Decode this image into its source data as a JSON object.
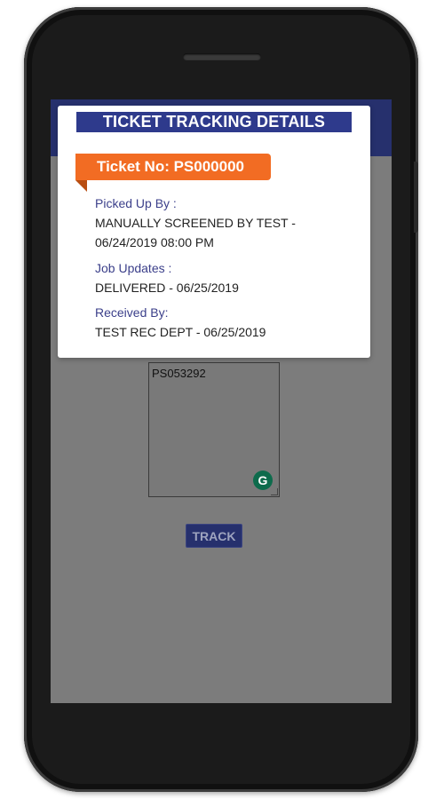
{
  "popup": {
    "title": "TICKET TRACKING DETAILS",
    "ticket_no": "Ticket No: PS000000",
    "fields": [
      {
        "label": "Picked Up By :",
        "value": "MANUALLY SCREENED BY TEST - 06/24/2019 08:00 PM"
      },
      {
        "label": "Job Updates :",
        "value": "DELIVERED - 06/25/2019"
      },
      {
        "label": "Received By:",
        "value": "TEST REC DEPT - 06/25/2019"
      }
    ]
  },
  "form": {
    "ticket_input_value": "PS053292",
    "track_label": "TRACK",
    "grammarly_glyph": "G"
  },
  "colors": {
    "header": "#26306d",
    "title_bar": "#2e3a8c",
    "badge": "#f26c23",
    "label": "#3b3f8a",
    "overlay": "#7c7c7c"
  }
}
